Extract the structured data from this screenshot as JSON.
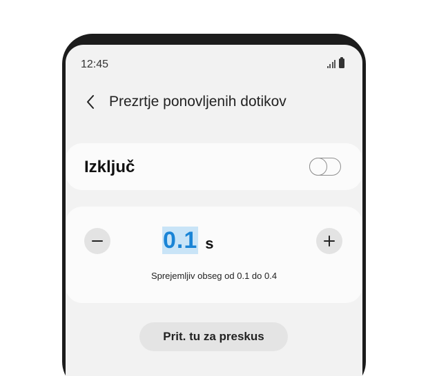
{
  "status_bar": {
    "time": "12:45",
    "icons": [
      "signal-icon",
      "battery-icon"
    ]
  },
  "header": {
    "back_icon": "chevron-left-icon",
    "title": "Prezrtje ponovljenih dotikov"
  },
  "toggle_card": {
    "label": "Izključ",
    "state": "off"
  },
  "stepper_card": {
    "minus_icon": "minus-icon",
    "plus_icon": "plus-icon",
    "value": "0.1",
    "unit": "s",
    "range_text": "Sprejemljiv obseg od 0.1 do 0.4"
  },
  "skip_button": {
    "label": "Prit. tu za preskus"
  },
  "colors": {
    "accent": "#1a84d6",
    "highlight": "#c9e4f7",
    "screen_bg": "#f2f2f2",
    "card_bg": "#fbfbfb",
    "frame": "#1c1c1c"
  }
}
